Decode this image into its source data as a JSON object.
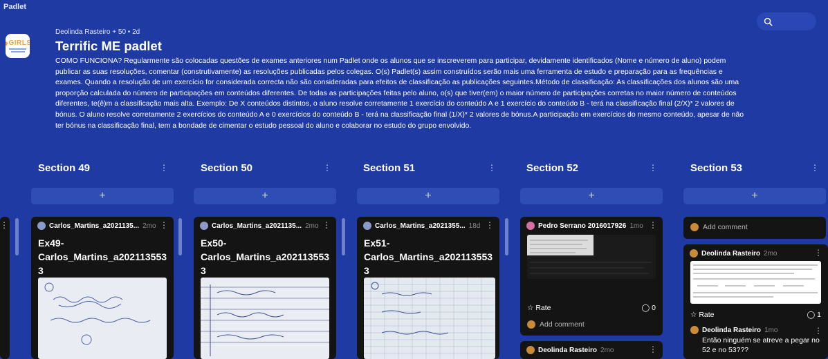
{
  "app": {
    "name": "Padlet"
  },
  "header": {
    "meta": "Deolinda Rasteiro  + 50  • 2d",
    "title": "Terrific ME padlet",
    "logo_text": "GIRLS",
    "description": "COMO FUNCIONA? Regularmente são colocadas questões de exames anteriores num Padlet onde os alunos que se inscreverem para participar, devidamente identificados (Nome e número de aluno) podem publicar as suas resoluções, comentar (construtivamente) as resoluções publicadas pelos colegas. O(s) Padlet(s) assim construídos serão mais uma ferramenta de estudo e preparação para as frequências e exames. Quando a resolução de um exercício for considerada correcta não são consideradas para efeitos de classificação as publicações seguintes.Método de classificação: As classificações dos alunos são uma proporção calculada do número de participações em conteúdos diferentes. De todas as participações feitas pelo aluno, o(s) que tiver(em) o maior número de participações corretas no maior número de conteúdos diferentes, te(ê)m a classificação mais alta. Exemplo: De X conteúdos distintos, o aluno resolve corretamente 1 exercício do conteúdo A e 1 exercício do conteúdo B - terá na classificação final (2/X)* 2 valores de bónus. O aluno resolve corretamente 2 exercícios do conteúdo A e 0 exercícios do conteúdo B - terá na classificação final (1/X)* 2 valores de bónus.A participação em exercícios do mesmo conteúdo, apesar de não ter bónus na classificação final, tem a bondade de cimentar o estudo pessoal do aluno e colaborar no estudo do grupo envolvido."
  },
  "ui": {
    "add_symbol": "+",
    "dots_symbol": "⋮"
  },
  "sections": [
    {
      "title": "Section 49"
    },
    {
      "title": "Section 50"
    },
    {
      "title": "Section 51"
    },
    {
      "title": "Section 52"
    },
    {
      "title": "Section 53"
    }
  ],
  "cards": {
    "c49": {
      "author": "Carlos_Martins_a2021135...",
      "time": "2mo",
      "title": "Ex49-\nCarlos_Martins_a202113553\n3"
    },
    "c50": {
      "author": "Carlos_Martins_a2021135...",
      "time": "2mo",
      "title": "Ex50-\nCarlos_Martins_a202113553\n3"
    },
    "c51": {
      "author": "Carlos_Martins_a2021355...",
      "time": "18d",
      "title": "Ex51-\nCarlos_Martins_a202113553\n3"
    },
    "c52": {
      "author": "Pedro Serrano 2016017926",
      "time": "1mo",
      "rate": "Rate",
      "comments": "0",
      "add_comment": "Add comment"
    },
    "c52b": {
      "author": "Deolinda Rasteiro",
      "time": "2mo"
    },
    "c53a": {
      "add_comment": "Add comment"
    },
    "c53b": {
      "author": "Deolinda Rasteiro",
      "time": "2mo",
      "rate": "Rate",
      "comments": "1",
      "reply_author": "Deolinda Rasteiro",
      "reply_time": "1mo",
      "reply_text": "Então ninguém se atreve a pegar no 52 e no 53???"
    }
  }
}
